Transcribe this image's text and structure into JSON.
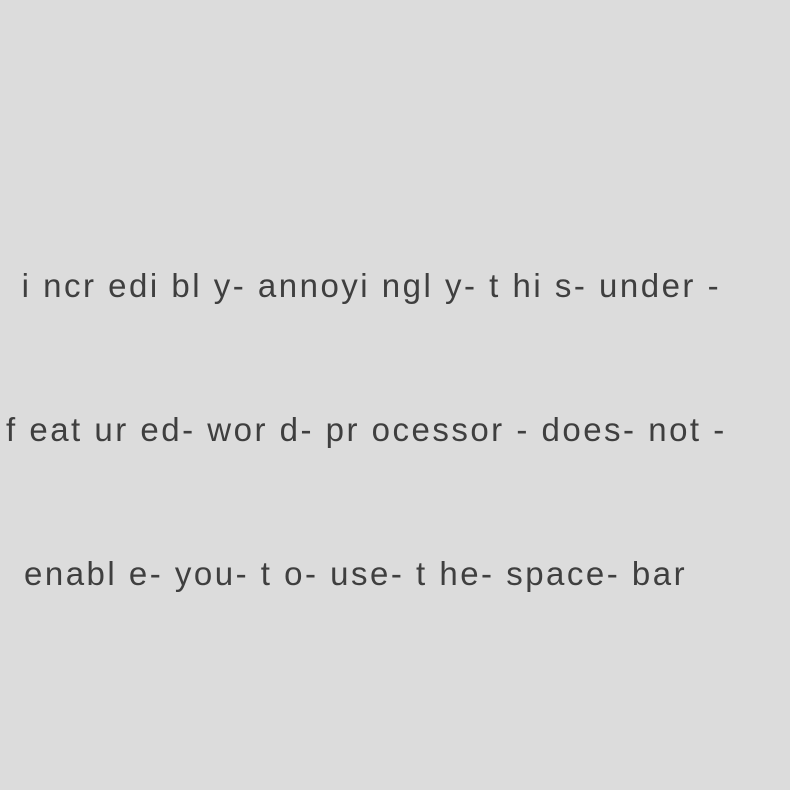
{
  "text": {
    "lines": [
      " i ncr edi bl y- annoyi ngl y- t hi s- under -",
      "f eat ur ed- wor d- pr ocessor - does- not -",
      "enabl e- you- t o- use- t he- space- bar"
    ]
  }
}
